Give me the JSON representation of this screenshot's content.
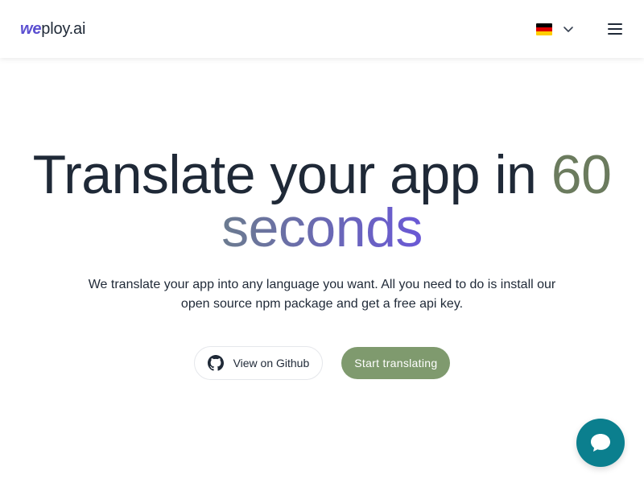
{
  "header": {
    "logo_prefix": "we",
    "logo_suffix": "ploy.ai",
    "language_flag": "de-flag-icon",
    "menu_icon": "hamburger-icon"
  },
  "hero": {
    "headline_part1": "Translate your app in ",
    "headline_accent_number": "60",
    "headline_accent_word": "seconds",
    "subtext": "We translate your app into any language you want. All you need to do is install our open source npm package and get a free api key.",
    "github_button": "View on Github",
    "start_button": "Start translating"
  },
  "colors": {
    "brand_purple": "#5b4fd1",
    "accent_green": "#7f9a6e",
    "chat_teal": "#0b7f8e"
  }
}
